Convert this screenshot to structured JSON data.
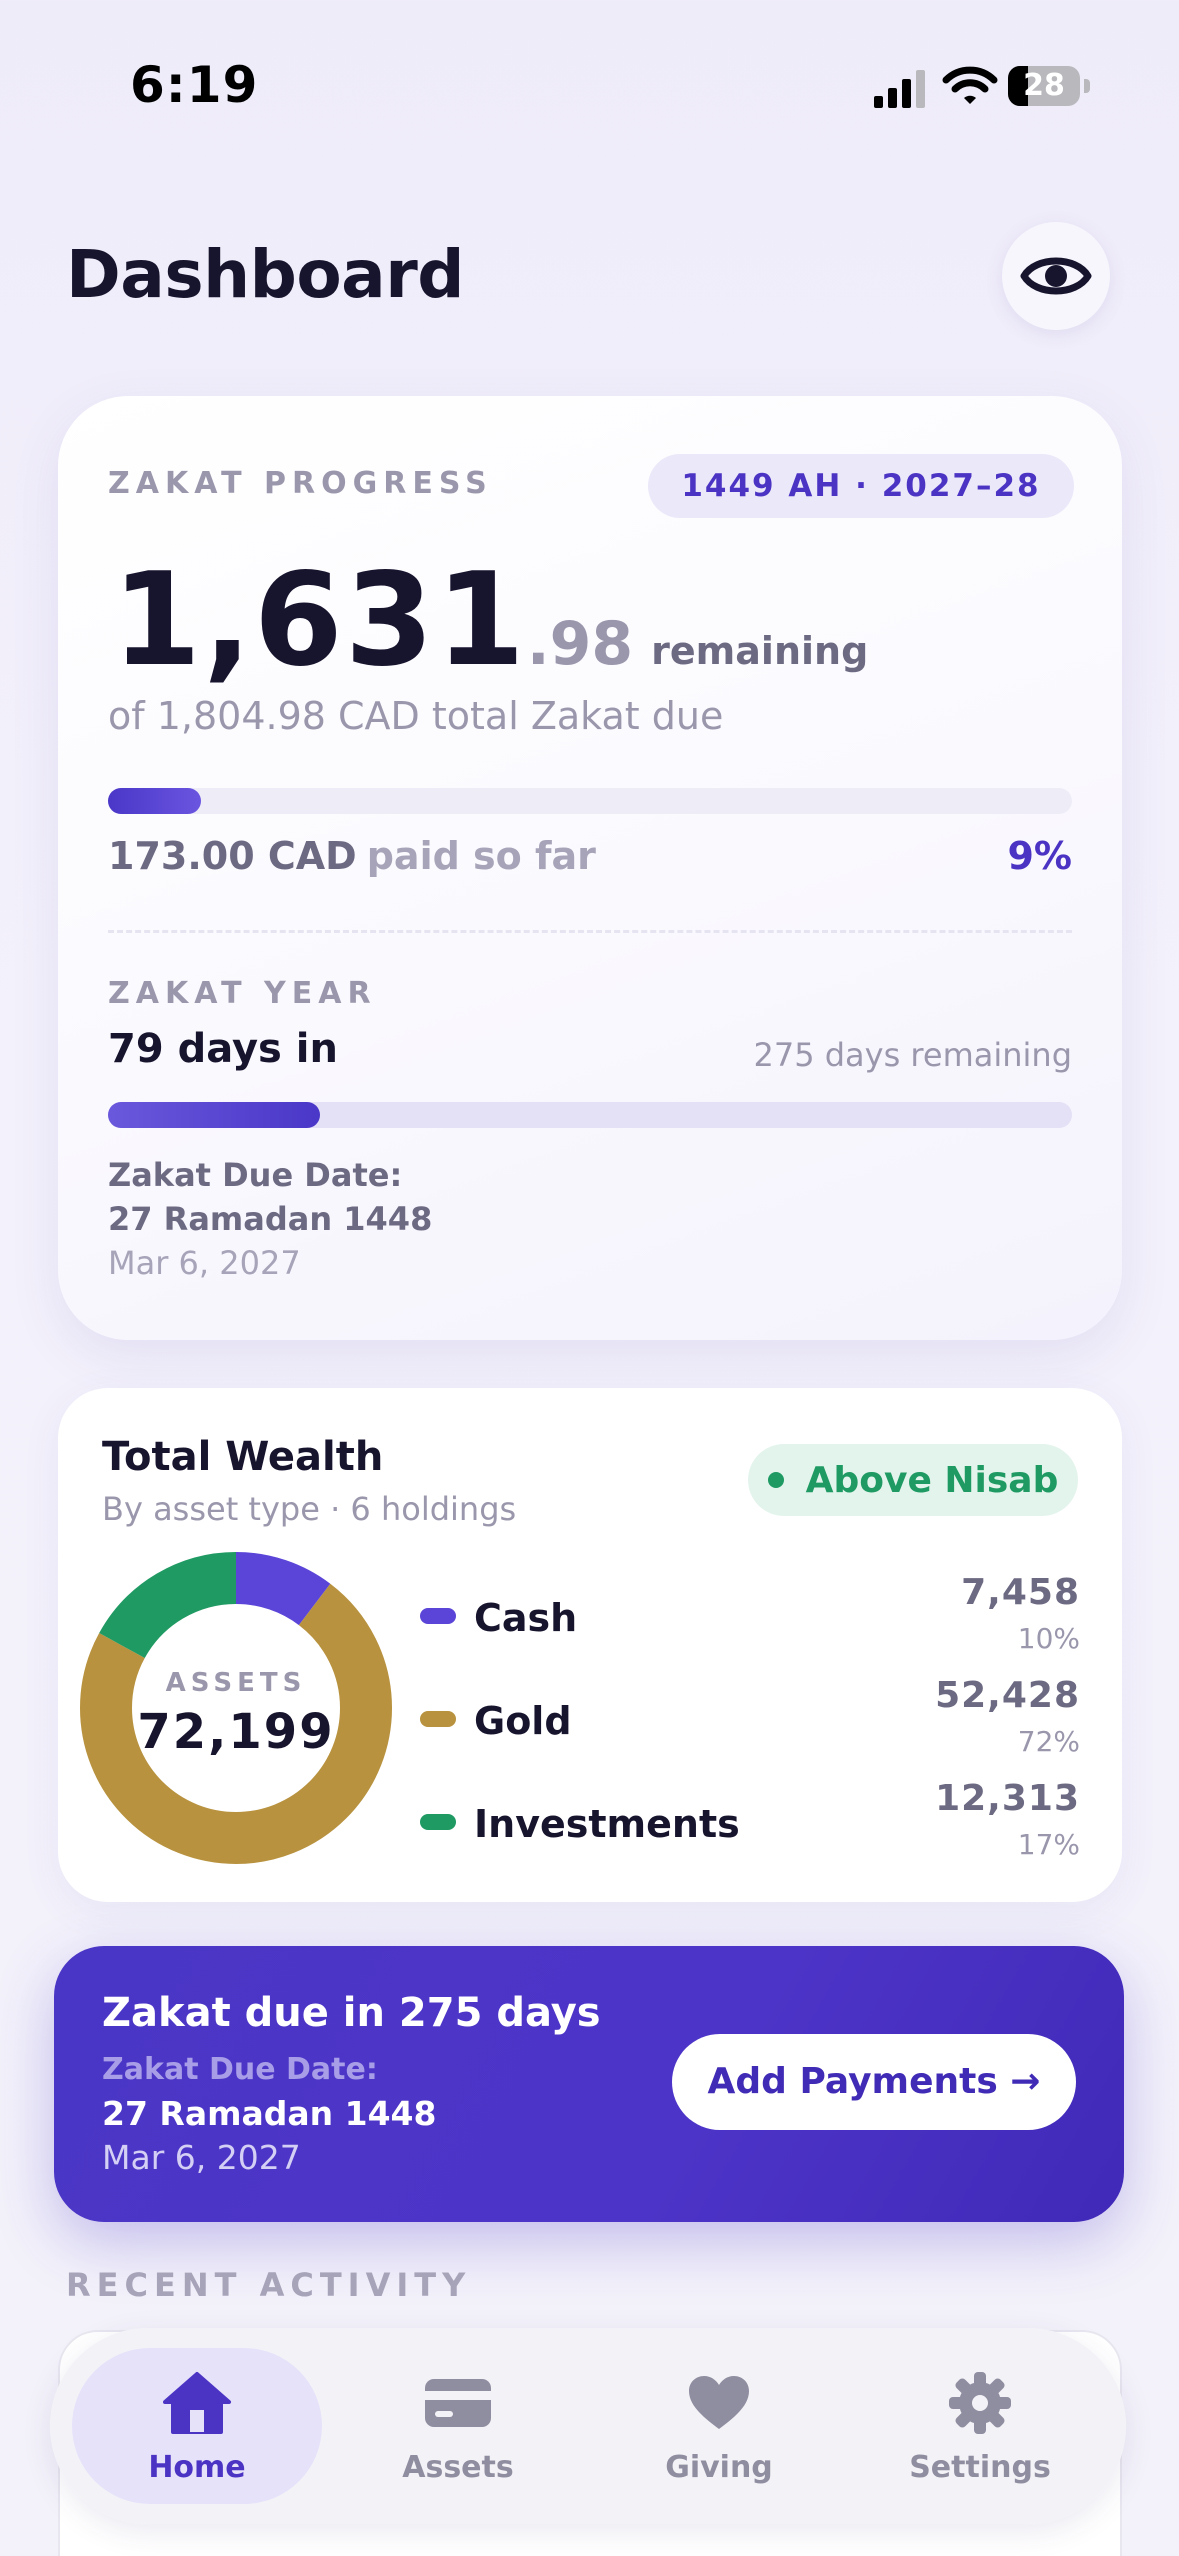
{
  "status_bar": {
    "time": "6:19",
    "battery": "28",
    "battery_level": 0.28
  },
  "header": {
    "title": "Dashboard",
    "eye_icon": "eye-icon"
  },
  "zakat_progress": {
    "label": "ZAKAT PROGRESS",
    "year_badge": "1449 AH · 2027–28",
    "remaining_int": "1,631",
    "remaining_dec": ".98",
    "remaining_word": "remaining",
    "total_due": "of 1,804.98 CAD total Zakat due",
    "paid_amount": "173.00 CAD",
    "paid_suffix": "paid so far",
    "paid_percent": "9%",
    "paid_fraction": 0.096
  },
  "zakat_year": {
    "label": "ZAKAT YEAR",
    "days_in": "79 days in",
    "days_remaining": "275 days remaining",
    "year_fraction": 0.22,
    "due_label": "Zakat Due Date:",
    "due_hijri": "27 Ramadan 1448",
    "due_gregorian": "Mar 6, 2027"
  },
  "wealth": {
    "title": "Total Wealth",
    "subtitle": "By asset type · 6 holdings",
    "nisab_status": "Above Nisab",
    "donut_label": "ASSETS",
    "donut_total": "72,199",
    "items": [
      {
        "name": "Cash",
        "value": "7,458",
        "percent": "10%",
        "amount": 7458,
        "color": "#5a45d8"
      },
      {
        "name": "Gold",
        "value": "52,428",
        "percent": "72%",
        "amount": 52428,
        "color": "#b8923e"
      },
      {
        "name": "Investments",
        "value": "12,313",
        "percent": "17%",
        "amount": 12313,
        "color": "#1f9a63"
      }
    ]
  },
  "cta": {
    "title": "Zakat due in 275 days",
    "due_label": "Zakat Due Date:",
    "due_hijri": "27 Ramadan 1448",
    "due_gregorian": "Mar 6, 2027",
    "button": "Add Payments →"
  },
  "recent": {
    "label": "RECENT ACTIVITY"
  },
  "tabs": [
    {
      "label": "Home",
      "icon": "home-icon",
      "active": true
    },
    {
      "label": "Assets",
      "icon": "card-icon",
      "active": false
    },
    {
      "label": "Giving",
      "icon": "heart-icon",
      "active": false
    },
    {
      "label": "Settings",
      "icon": "gear-icon",
      "active": false
    }
  ],
  "colors": {
    "accent": "#4b33c4",
    "success": "#1f9a63",
    "gold": "#b8923e",
    "text": "#17142e"
  }
}
